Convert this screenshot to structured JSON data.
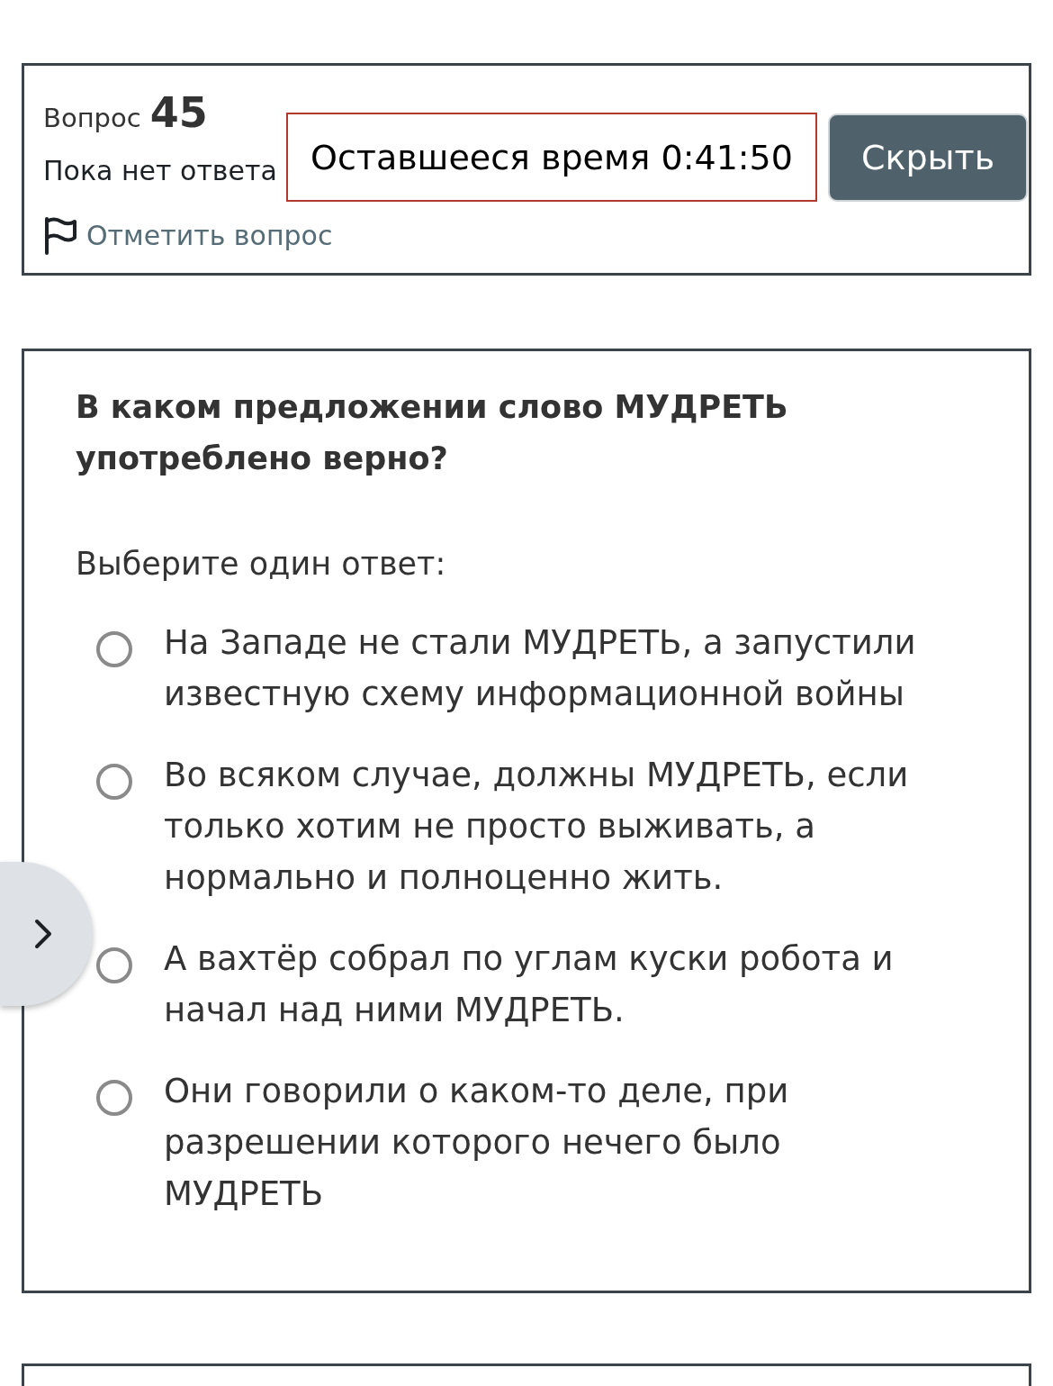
{
  "question_info": {
    "label": "Вопрос",
    "number": "45",
    "status": "Пока нет ответа",
    "flag": {
      "label": "Отметить вопрос",
      "flagged": false
    }
  },
  "timer": {
    "text": "Оставшееся время 0:41:50",
    "hide_button": "Скрыть"
  },
  "drawer_toggle": {
    "expanded": false
  },
  "question": {
    "text": "В каком предложении слово МУДРЕТЬ употреблено верно?",
    "prompt": "Выберите один ответ:",
    "options": [
      {
        "text": "На Западе не стали МУДРЕТЬ, а запустили известную схему информационной войны",
        "selected": false
      },
      {
        "text": "Во всяком случае, должны МУДРЕТЬ, если только хотим не просто выживать, а нормально и полноценно жить.",
        "selected": false
      },
      {
        "text": "А вахтёр собрал по углам куски робота и начал над ними МУДРЕТЬ.",
        "selected": false
      },
      {
        "text": "Они говорили о каком-то деле, при разрешении которого нечего было МУДРЕТЬ",
        "selected": false
      }
    ]
  }
}
